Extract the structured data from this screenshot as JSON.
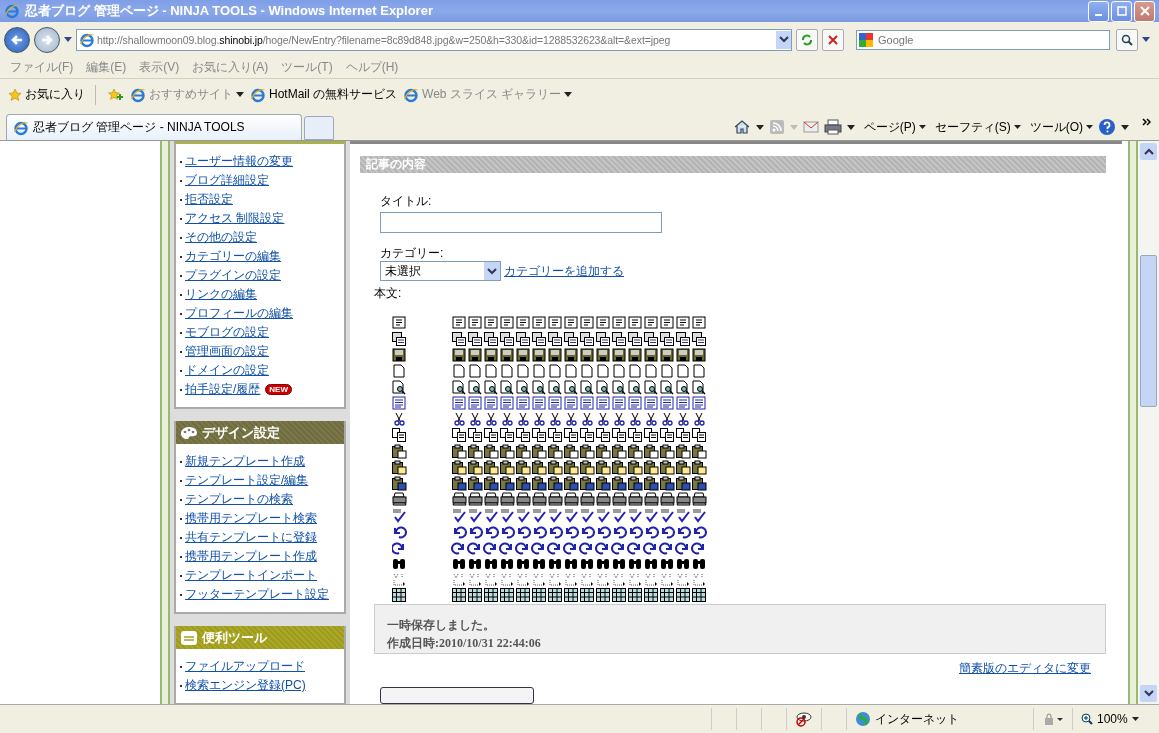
{
  "window": {
    "title": "忍者ブログ 管理ページ - NINJA TOOLS - Windows Internet Explorer"
  },
  "address_bar": {
    "url_start": "http://shallowmoon09.blog.",
    "url_host": "shinobi.jp",
    "url_end": "/hoge/NewEntry?filename=8c89d848.jpg&w=250&h=330&id=1288532623&alt=&ext=jpeg"
  },
  "search": {
    "placeholder": "Google"
  },
  "menu": [
    "ファイル(F)",
    "編集(E)",
    "表示(V)",
    "お気に入り(A)",
    "ツール(T)",
    "ヘルプ(H)"
  ],
  "favorites": {
    "label": "お気に入り",
    "links": [
      {
        "label": "おすすめサイト",
        "dropdown": true,
        "disabled": true
      },
      {
        "label": "HotMail の無料サービス",
        "dropdown": false,
        "disabled": false
      },
      {
        "label": "Web スライス ギャラリー",
        "dropdown": true,
        "disabled": true
      }
    ]
  },
  "tabs": [
    {
      "label": "忍者ブログ 管理ページ - NINJA TOOLS",
      "selected": true
    }
  ],
  "command_bar": [
    "ページ(P)",
    "セーフティ(S)",
    "ツール(O)"
  ],
  "sidebar": [
    {
      "kind": "plain",
      "items": [
        {
          "label": "ユーザー情報の変更"
        },
        {
          "label": "ブログ詳細設定"
        },
        {
          "label": "拒否設定"
        },
        {
          "label": "アクセス 制限設定"
        },
        {
          "label": "その他の設定"
        },
        {
          "label": "カテゴリーの編集"
        },
        {
          "label": "プラグインの設定"
        },
        {
          "label": "リンクの編集"
        },
        {
          "label": "プロフィールの編集"
        },
        {
          "label": "モブログの設定"
        },
        {
          "label": "管理画面の設定"
        },
        {
          "label": "ドメインの設定"
        },
        {
          "label": "拍手設定/履歴",
          "badge": "NEW"
        }
      ]
    },
    {
      "title": "デザイン設定",
      "kind": "design",
      "items": [
        {
          "label": "新規テンプレート作成"
        },
        {
          "label": "テンプレート設定/編集"
        },
        {
          "label": "テンプレートの検索"
        },
        {
          "label": "携帯用テンプレート検索"
        },
        {
          "label": "共有テンプレートに登録"
        },
        {
          "label": "携帯用テンプレート作成"
        },
        {
          "label": "テンプレートインポート"
        },
        {
          "label": "フッターテンプレート設定"
        }
      ]
    },
    {
      "title": "便利ツール",
      "kind": "tools",
      "items": [
        {
          "label": "ファイルアップロード"
        },
        {
          "label": "検索エンジン登録(PC)"
        }
      ]
    }
  ],
  "main": {
    "section_title": "記事の内容",
    "title_label": "タイトル:",
    "category_label": "カテゴリー:",
    "category_value": "未選択",
    "add_category": "カテゴリーを追加する",
    "body_label": "本文:",
    "notice": [
      "一時保存しました。",
      "作成日時:2010/10/31 22:44:06"
    ],
    "editor_switch": "簡素版のエディタに変更"
  },
  "status_bar": {
    "zone": "インターネット",
    "zoom": "100%"
  }
}
